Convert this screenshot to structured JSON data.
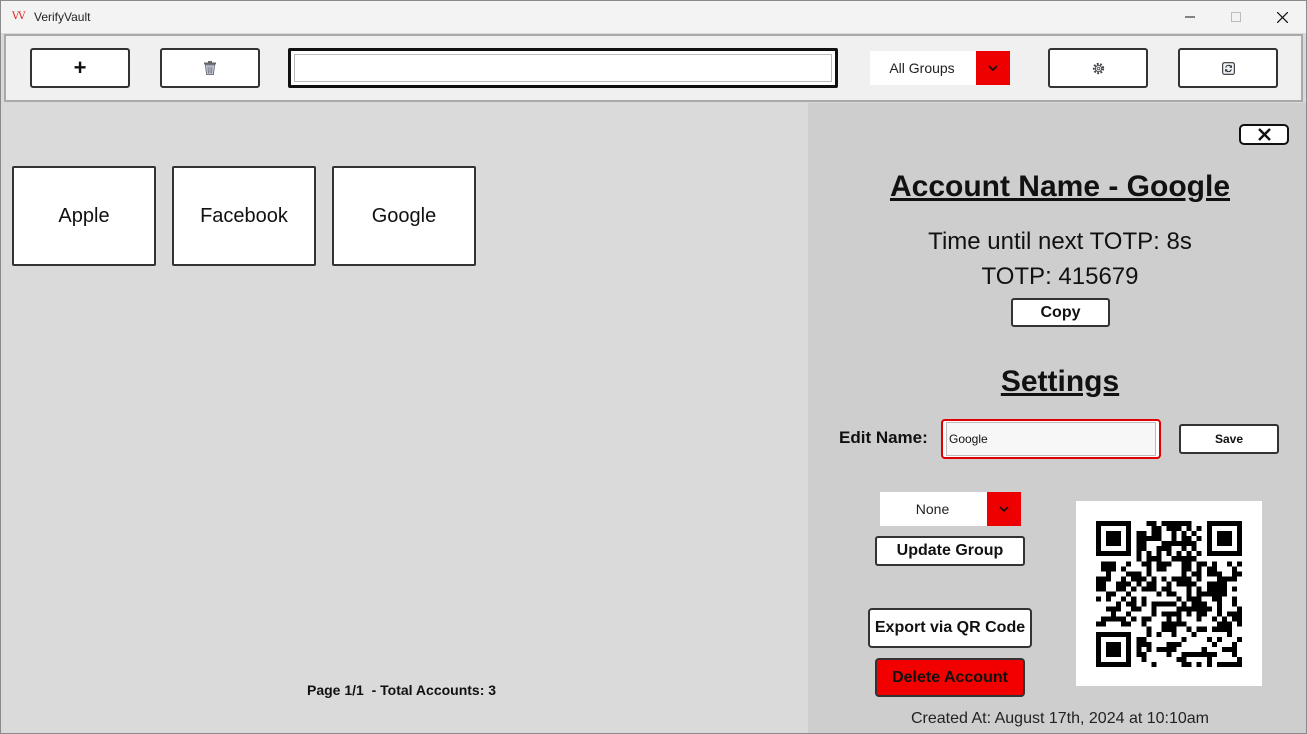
{
  "window": {
    "title": "VerifyVault",
    "logo_text": "VV"
  },
  "toolbar": {
    "add_label": "+",
    "search_value": "",
    "group_filter": "All Groups"
  },
  "accounts": [
    {
      "name": "Apple"
    },
    {
      "name": "Facebook"
    },
    {
      "name": "Google"
    }
  ],
  "pagination": {
    "text": "Page 1/1  - Total Accounts: 3"
  },
  "detail": {
    "account_title": "Account Name - Google",
    "totp_time": "Time until next TOTP: 8s",
    "totp_code": "TOTP: 415679",
    "copy_label": "Copy",
    "settings_title": "Settings",
    "edit_name_label": "Edit Name:",
    "edit_name_value": "Google",
    "save_label": "Save",
    "group_value": "None",
    "update_group_label": "Update Group",
    "export_label": "Export via QR Code",
    "delete_label": "Delete Account",
    "created_at": "Created At: August 17th, 2024 at 10:10am"
  },
  "colors": {
    "accent_red": "#ee0000",
    "panel_bg": "#cecece",
    "list_bg": "#dadada"
  },
  "icons": {
    "add": "plus-icon",
    "delete": "trash-icon",
    "settings": "gear-icon",
    "refresh": "refresh-icon",
    "dropdown": "chevron-down-icon",
    "close": "close-icon"
  }
}
